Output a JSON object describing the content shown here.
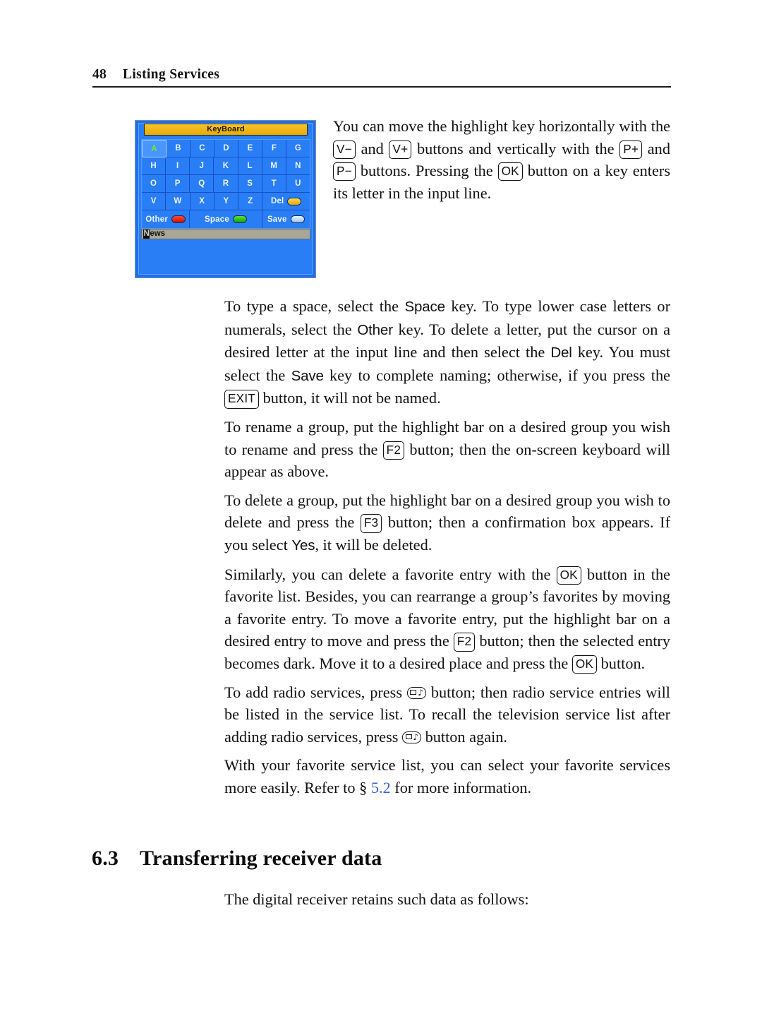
{
  "header": {
    "folio": "48",
    "title": "Listing Services"
  },
  "figure": {
    "title": "KeyBoard",
    "rows": [
      [
        "A",
        "B",
        "C",
        "D",
        "E",
        "F",
        "G"
      ],
      [
        "H",
        "I",
        "J",
        "K",
        "L",
        "M",
        "N"
      ],
      [
        "O",
        "P",
        "Q",
        "R",
        "S",
        "T",
        "U"
      ],
      [
        "V",
        "W",
        "X",
        "Y",
        "Z"
      ]
    ],
    "selected_key": "A",
    "del_label": "Del",
    "other_label": "Other",
    "space_label": "Space",
    "save_label": "Save",
    "input_caret_char": "N",
    "input_rest": "ews",
    "input_value": "News",
    "colors": {
      "panel_blue": "#2a7ef5",
      "title_bar": "#eeb419",
      "selected_key_text": "#5df03a",
      "del_dot": "#f2bb19",
      "other_dot": "#e02a16",
      "space_dot": "#2cc812",
      "save_dot": "#cfe2fb",
      "input_bar": "#a9a695"
    }
  },
  "paragraphs": {
    "p1": {
      "t1": "You can move the highlight key horizontally with the ",
      "key_vminus": "V−",
      "t2": " and ",
      "key_vplus": "V+",
      "t3": " buttons and vertically with the ",
      "key_pplus": "P+",
      "t4": " and ",
      "key_pminus": "P−",
      "t5": " buttons. Pressing the ",
      "key_ok": "OK",
      "t6": " button on a key enters its letter in the input line."
    },
    "p2": {
      "t1": "To type a space, select the ",
      "k_space": "Space",
      "t2": " key. To type lower case letters or numerals, select the ",
      "k_other": "Other",
      "t3": " key. To delete a letter, put the cursor on a desired letter at the input line and then select the ",
      "k_del": "Del",
      "t4": " key. You must select the ",
      "k_save": "Save",
      "t5": " key to complete naming; otherwise, if you press the ",
      "key_exit": "EXIT",
      "t6": " button, it will not be named."
    },
    "p3": {
      "t1": "To rename a group, put the highlight bar on a desired group you wish to rename and press the ",
      "key_f2": "F2",
      "t2": " button; then the on-screen keyboard will appear as above."
    },
    "p4": {
      "t1": "To delete a group, put the highlight bar on a desired group you wish to delete and press the ",
      "key_f3": "F3",
      "t2": " button; then a confirmation box appears. If you select ",
      "k_yes": "Yes",
      "t3": ", it will be deleted."
    },
    "p5": {
      "t1": "Similarly, you can delete a favorite entry with the ",
      "key_ok1": "OK",
      "t2": " button in the favorite list. Besides, you can rearrange a group’s favorites by moving a favorite entry. To move a favorite entry, put the highlight bar on a desired entry to move and press the ",
      "key_f2": "F2",
      "t3": " button; then the selected entry becomes dark. Move it to a desired place and press the ",
      "key_ok2": "OK",
      "t4": " button."
    },
    "p6": {
      "t1": "To add radio services, press ",
      "t2": " button; then radio service entries will be listed in the service list. To recall the television service list after adding radio services, press ",
      "t3": " button again."
    },
    "p7": {
      "t1": "With your favorite service list, you can select your favorite services more easily. Refer to § ",
      "xref": "5.2",
      "t2": " for more information."
    }
  },
  "section": {
    "number": "6.3",
    "title": "Transferring receiver data",
    "intro": "The digital receiver retains such data as follows:"
  }
}
